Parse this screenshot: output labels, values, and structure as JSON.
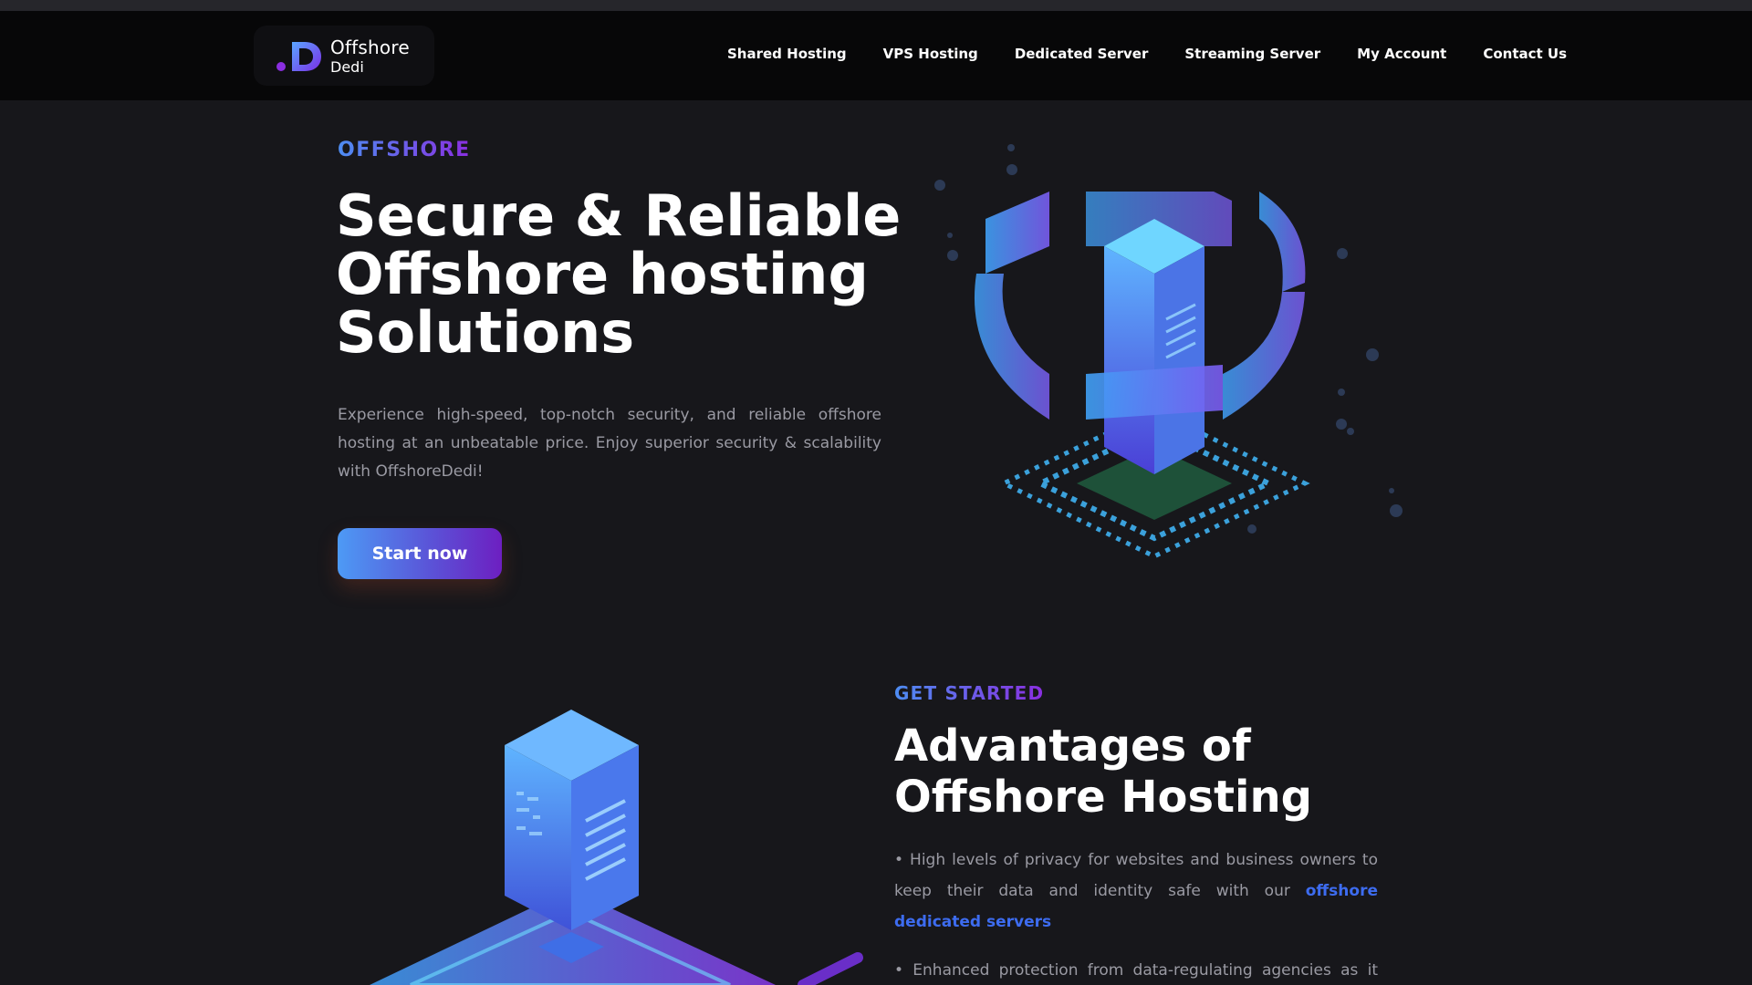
{
  "brand": {
    "name_line1": "Offshore",
    "name_line2": "Dedi",
    "mark_letter": "D"
  },
  "nav": {
    "items": [
      {
        "label": "Shared Hosting"
      },
      {
        "label": "VPS Hosting"
      },
      {
        "label": "Dedicated Server"
      },
      {
        "label": "Streaming Server"
      },
      {
        "label": "My Account"
      },
      {
        "label": "Contact Us"
      }
    ]
  },
  "hero": {
    "eyebrow": "OFFSHORE",
    "title_line1": "Secure & Reliable",
    "title_line2": "Offshore hosting",
    "title_line3": "Solutions",
    "description": "Experience high-speed, top-notch security, and reliable offshore hosting at an unbeatable price. Enjoy superior security & scalability with OffshoreDedi!",
    "cta_label": "Start now"
  },
  "advantages": {
    "eyebrow": "GET STARTED",
    "title_line1": "Advantages of",
    "title_line2": "Offshore Hosting",
    "bullet1_text": "• High levels of privacy for websites and business owners to keep their data and identity safe with our ",
    "bullet1_link": "offshore dedicated servers",
    "bullet2_text": "• Enhanced protection from data-regulating agencies as it offers"
  },
  "colors": {
    "background": "#17171b",
    "navbar": "#070708",
    "accent_blue": "#4d8df2",
    "accent_purple": "#8a2ee0",
    "link": "#3d6cf0",
    "muted_text": "#9a9aa3"
  },
  "icons": {
    "hero_illustration": "isometric-server-ring-illustration",
    "section_illustration": "isometric-server-stack-illustration"
  }
}
